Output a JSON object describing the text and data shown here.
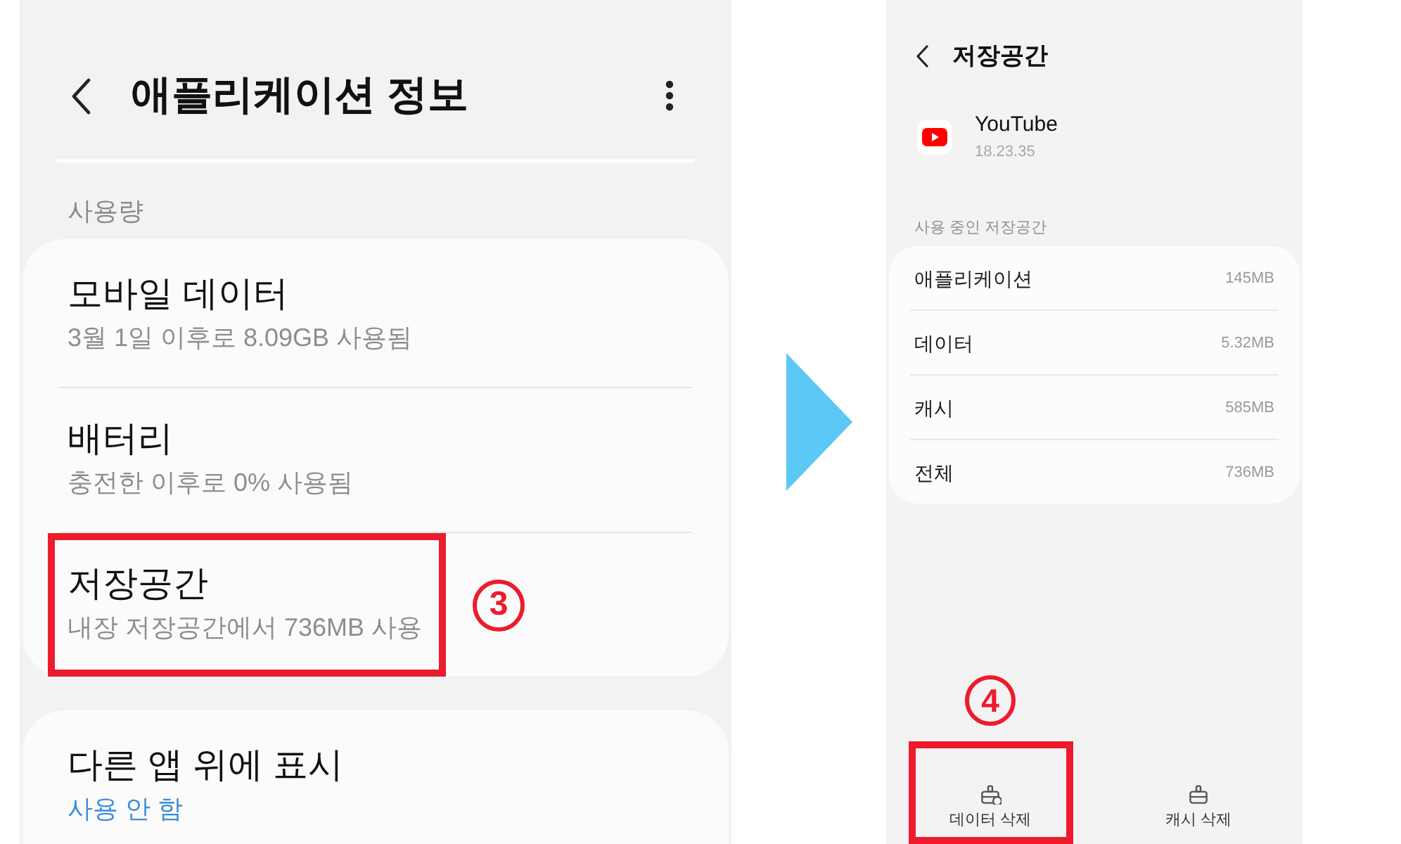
{
  "app_info_screen": {
    "title": "애플리케이션 정보",
    "section_label": "사용량",
    "cards": [
      {
        "items": [
          {
            "kind": "usage",
            "title": "모바일 데이터",
            "subtitle": "3월 1일 이후로 8.09GB 사용됨",
            "highlighted": false
          },
          {
            "kind": "usage",
            "title": "배터리",
            "subtitle": "충전한 이후로 0% 사용됨",
            "highlighted": false
          },
          {
            "kind": "usage",
            "title": "저장공간",
            "subtitle": "내장 저장공간에서 736MB 사용",
            "highlighted": true,
            "step": "3"
          }
        ]
      },
      {
        "items": [
          {
            "kind": "setting",
            "title": "다른 앱 위에 표시",
            "subtitle": "사용 안 함",
            "highlighted": false
          }
        ]
      }
    ]
  },
  "storage_screen": {
    "title": "저장공간",
    "app": {
      "name": "YouTube",
      "version": "18.23.35"
    },
    "section_label": "사용 중인 저장공간",
    "rows": [
      {
        "label": "애플리케이션",
        "value": "145MB"
      },
      {
        "label": "데이터",
        "value": "5.32MB"
      },
      {
        "label": "캐시",
        "value": "585MB"
      },
      {
        "label": "전체",
        "value": "736MB"
      }
    ],
    "actions": [
      {
        "label": "데이터 삭제",
        "highlighted": true,
        "step": "4"
      },
      {
        "label": "캐시 삭제",
        "highlighted": false
      }
    ]
  }
}
